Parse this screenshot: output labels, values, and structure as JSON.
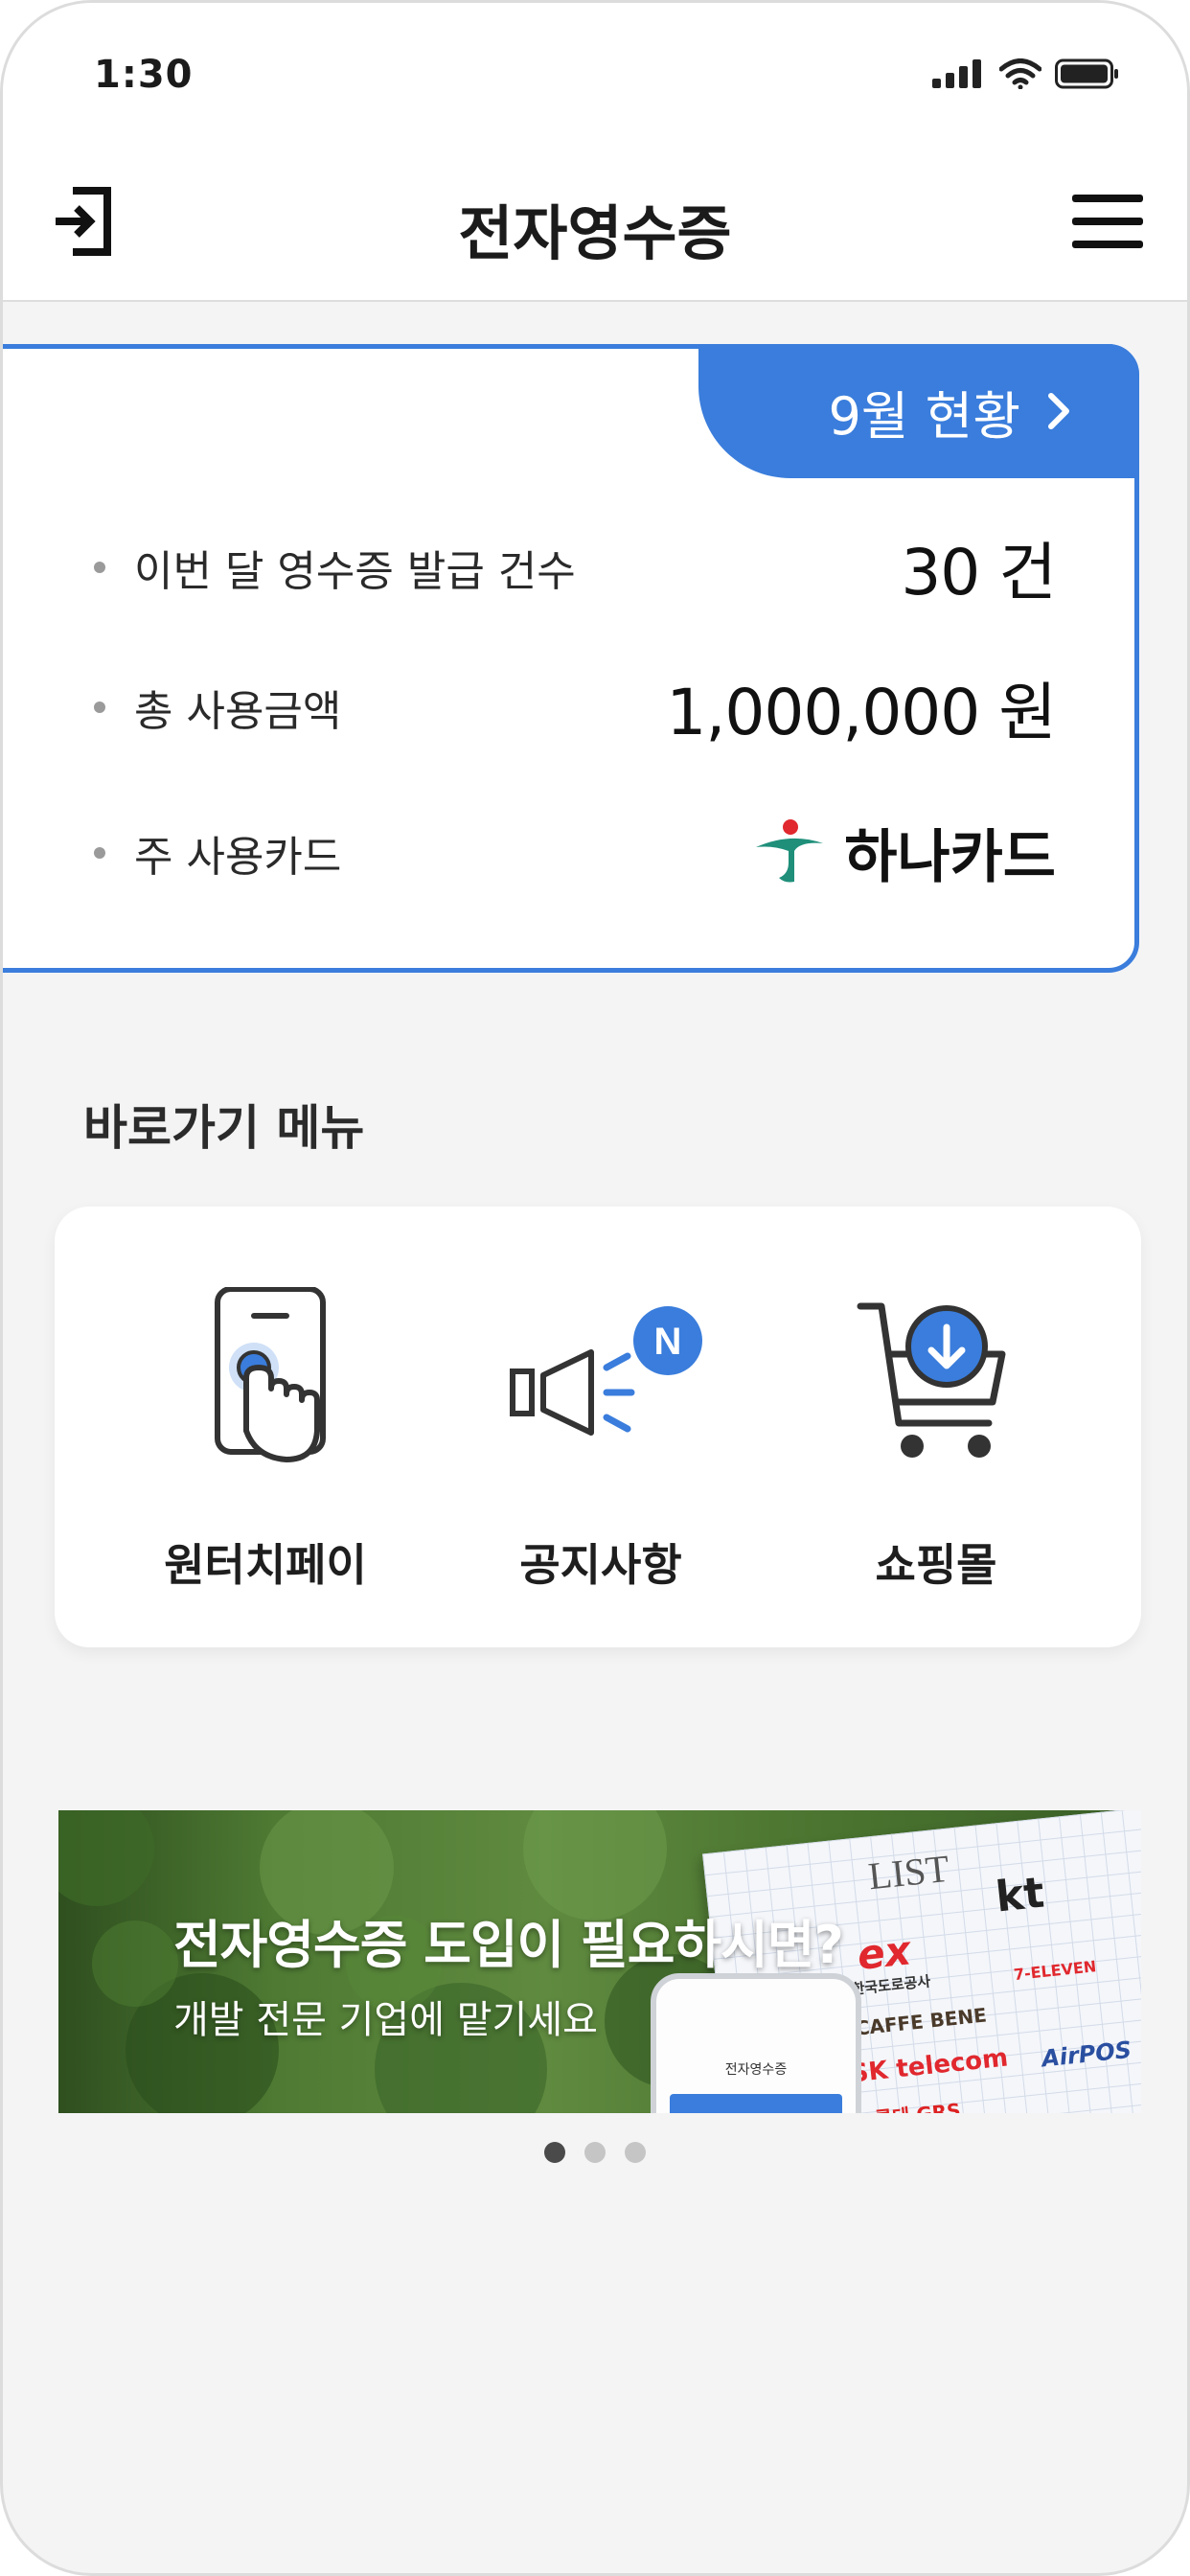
{
  "status_bar": {
    "time": "1:30"
  },
  "header": {
    "title": "전자영수증"
  },
  "summary": {
    "month_tab": "9월 현황",
    "rows": [
      {
        "label": "이번 달 영수증 발급 건수",
        "value": "30 건"
      },
      {
        "label": "총 사용금액",
        "value": "1,000,000 원"
      },
      {
        "label": "주 사용카드",
        "value": "하나카드"
      }
    ]
  },
  "shortcut": {
    "title": "바로가기 메뉴",
    "items": [
      {
        "label": "원터치페이",
        "icon": "touch-pay-icon"
      },
      {
        "label": "공지사항",
        "icon": "megaphone-icon",
        "badge": "N"
      },
      {
        "label": "쇼핑몰",
        "icon": "shopping-cart-icon"
      }
    ]
  },
  "banner": {
    "headline": "전자영수증 도입이 필요하시면?",
    "subtext": "개발 전문 기업에 맡기세요",
    "phone_title": "전자영수증",
    "paper_title": "LIST",
    "logos": [
      "kt",
      "ex",
      "한국도로공사",
      "7-ELEVEN",
      "CAFFE BENE",
      "SK telecom",
      "AirPOS",
      "롯데 GRS"
    ]
  },
  "pager": {
    "count": 3,
    "active": 0
  },
  "colors": {
    "accent": "#3a7ddc",
    "brand_green": "#1f8f7a",
    "brand_red": "#e0282e"
  }
}
